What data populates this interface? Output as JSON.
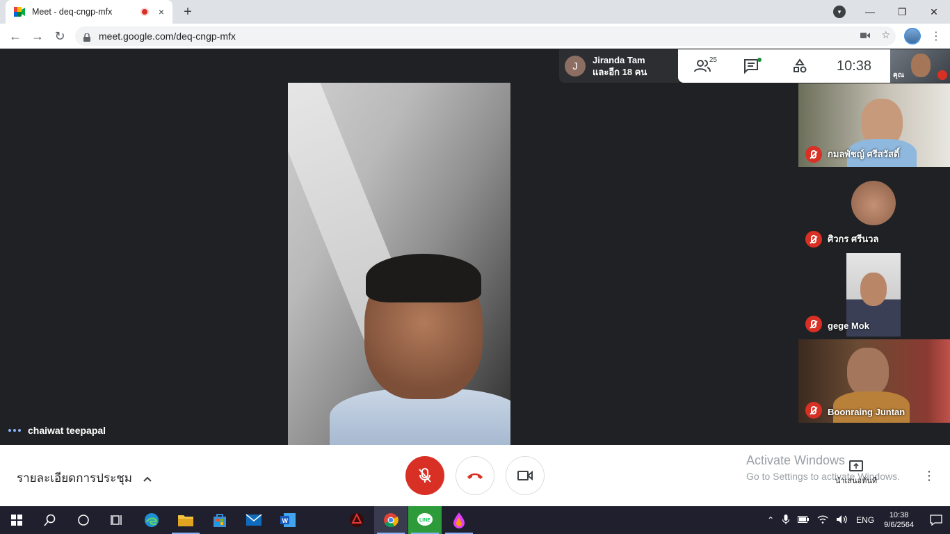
{
  "browser": {
    "tab_title": "Meet - deq-cngp-mfx",
    "tab_close": "×",
    "new_tab": "+",
    "url": "meet.google.com/deq-cngp-mfx",
    "menu_glyph": "⋮"
  },
  "window": {
    "minimize": "—",
    "maximize": "❐",
    "close": "✕"
  },
  "meeting": {
    "presenter_chip": {
      "avatar_letter": "J",
      "line1": "Jiranda Tam",
      "line2": "และอีก 18 คน"
    },
    "people_count": "25",
    "time": "10:38",
    "self_label": "คุณ",
    "main_speaker": "chaiwat teepapal",
    "side_tiles": [
      {
        "name": "กมลพัชญ์ ศรีสวัสดิ์"
      },
      {
        "name": "ศิวกร ศรีนวล"
      },
      {
        "name": "gege Mok"
      },
      {
        "name": "Boonraing Juntan"
      }
    ]
  },
  "bottom_bar": {
    "details_label": "รายละเอียดการประชุม",
    "present_label": "นำเสนอทันที",
    "activate_line1": "Activate Windows",
    "activate_line2": "Go to Settings to activate Windows."
  },
  "taskbar": {
    "lang": "ENG",
    "clock_time": "10:38",
    "clock_date": "9/6/2564"
  },
  "colors": {
    "meet_bg": "#202124",
    "danger": "#d93025",
    "accent": "#8ab4f8"
  }
}
